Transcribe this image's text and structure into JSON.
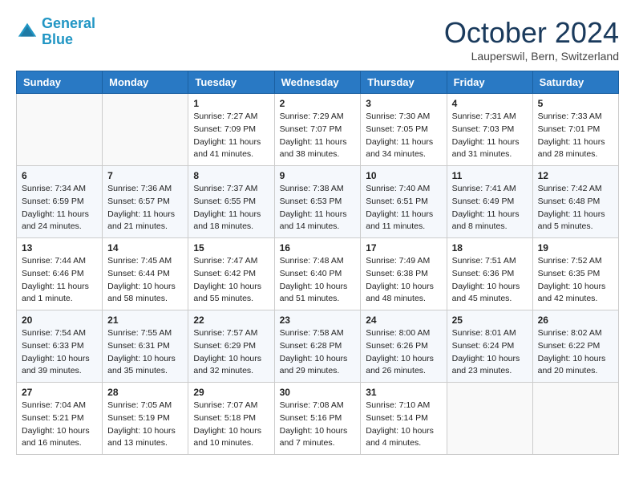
{
  "header": {
    "logo_general": "General",
    "logo_blue": "Blue",
    "title": "October 2024",
    "location": "Lauperswil, Bern, Switzerland"
  },
  "days_of_week": [
    "Sunday",
    "Monday",
    "Tuesday",
    "Wednesday",
    "Thursday",
    "Friday",
    "Saturday"
  ],
  "weeks": [
    [
      {
        "day": "",
        "sunrise": "",
        "sunset": "",
        "daylight": ""
      },
      {
        "day": "",
        "sunrise": "",
        "sunset": "",
        "daylight": ""
      },
      {
        "day": "1",
        "sunrise": "Sunrise: 7:27 AM",
        "sunset": "Sunset: 7:09 PM",
        "daylight": "Daylight: 11 hours and 41 minutes."
      },
      {
        "day": "2",
        "sunrise": "Sunrise: 7:29 AM",
        "sunset": "Sunset: 7:07 PM",
        "daylight": "Daylight: 11 hours and 38 minutes."
      },
      {
        "day": "3",
        "sunrise": "Sunrise: 7:30 AM",
        "sunset": "Sunset: 7:05 PM",
        "daylight": "Daylight: 11 hours and 34 minutes."
      },
      {
        "day": "4",
        "sunrise": "Sunrise: 7:31 AM",
        "sunset": "Sunset: 7:03 PM",
        "daylight": "Daylight: 11 hours and 31 minutes."
      },
      {
        "day": "5",
        "sunrise": "Sunrise: 7:33 AM",
        "sunset": "Sunset: 7:01 PM",
        "daylight": "Daylight: 11 hours and 28 minutes."
      }
    ],
    [
      {
        "day": "6",
        "sunrise": "Sunrise: 7:34 AM",
        "sunset": "Sunset: 6:59 PM",
        "daylight": "Daylight: 11 hours and 24 minutes."
      },
      {
        "day": "7",
        "sunrise": "Sunrise: 7:36 AM",
        "sunset": "Sunset: 6:57 PM",
        "daylight": "Daylight: 11 hours and 21 minutes."
      },
      {
        "day": "8",
        "sunrise": "Sunrise: 7:37 AM",
        "sunset": "Sunset: 6:55 PM",
        "daylight": "Daylight: 11 hours and 18 minutes."
      },
      {
        "day": "9",
        "sunrise": "Sunrise: 7:38 AM",
        "sunset": "Sunset: 6:53 PM",
        "daylight": "Daylight: 11 hours and 14 minutes."
      },
      {
        "day": "10",
        "sunrise": "Sunrise: 7:40 AM",
        "sunset": "Sunset: 6:51 PM",
        "daylight": "Daylight: 11 hours and 11 minutes."
      },
      {
        "day": "11",
        "sunrise": "Sunrise: 7:41 AM",
        "sunset": "Sunset: 6:49 PM",
        "daylight": "Daylight: 11 hours and 8 minutes."
      },
      {
        "day": "12",
        "sunrise": "Sunrise: 7:42 AM",
        "sunset": "Sunset: 6:48 PM",
        "daylight": "Daylight: 11 hours and 5 minutes."
      }
    ],
    [
      {
        "day": "13",
        "sunrise": "Sunrise: 7:44 AM",
        "sunset": "Sunset: 6:46 PM",
        "daylight": "Daylight: 11 hours and 1 minute."
      },
      {
        "day": "14",
        "sunrise": "Sunrise: 7:45 AM",
        "sunset": "Sunset: 6:44 PM",
        "daylight": "Daylight: 10 hours and 58 minutes."
      },
      {
        "day": "15",
        "sunrise": "Sunrise: 7:47 AM",
        "sunset": "Sunset: 6:42 PM",
        "daylight": "Daylight: 10 hours and 55 minutes."
      },
      {
        "day": "16",
        "sunrise": "Sunrise: 7:48 AM",
        "sunset": "Sunset: 6:40 PM",
        "daylight": "Daylight: 10 hours and 51 minutes."
      },
      {
        "day": "17",
        "sunrise": "Sunrise: 7:49 AM",
        "sunset": "Sunset: 6:38 PM",
        "daylight": "Daylight: 10 hours and 48 minutes."
      },
      {
        "day": "18",
        "sunrise": "Sunrise: 7:51 AM",
        "sunset": "Sunset: 6:36 PM",
        "daylight": "Daylight: 10 hours and 45 minutes."
      },
      {
        "day": "19",
        "sunrise": "Sunrise: 7:52 AM",
        "sunset": "Sunset: 6:35 PM",
        "daylight": "Daylight: 10 hours and 42 minutes."
      }
    ],
    [
      {
        "day": "20",
        "sunrise": "Sunrise: 7:54 AM",
        "sunset": "Sunset: 6:33 PM",
        "daylight": "Daylight: 10 hours and 39 minutes."
      },
      {
        "day": "21",
        "sunrise": "Sunrise: 7:55 AM",
        "sunset": "Sunset: 6:31 PM",
        "daylight": "Daylight: 10 hours and 35 minutes."
      },
      {
        "day": "22",
        "sunrise": "Sunrise: 7:57 AM",
        "sunset": "Sunset: 6:29 PM",
        "daylight": "Daylight: 10 hours and 32 minutes."
      },
      {
        "day": "23",
        "sunrise": "Sunrise: 7:58 AM",
        "sunset": "Sunset: 6:28 PM",
        "daylight": "Daylight: 10 hours and 29 minutes."
      },
      {
        "day": "24",
        "sunrise": "Sunrise: 8:00 AM",
        "sunset": "Sunset: 6:26 PM",
        "daylight": "Daylight: 10 hours and 26 minutes."
      },
      {
        "day": "25",
        "sunrise": "Sunrise: 8:01 AM",
        "sunset": "Sunset: 6:24 PM",
        "daylight": "Daylight: 10 hours and 23 minutes."
      },
      {
        "day": "26",
        "sunrise": "Sunrise: 8:02 AM",
        "sunset": "Sunset: 6:22 PM",
        "daylight": "Daylight: 10 hours and 20 minutes."
      }
    ],
    [
      {
        "day": "27",
        "sunrise": "Sunrise: 7:04 AM",
        "sunset": "Sunset: 5:21 PM",
        "daylight": "Daylight: 10 hours and 16 minutes."
      },
      {
        "day": "28",
        "sunrise": "Sunrise: 7:05 AM",
        "sunset": "Sunset: 5:19 PM",
        "daylight": "Daylight: 10 hours and 13 minutes."
      },
      {
        "day": "29",
        "sunrise": "Sunrise: 7:07 AM",
        "sunset": "Sunset: 5:18 PM",
        "daylight": "Daylight: 10 hours and 10 minutes."
      },
      {
        "day": "30",
        "sunrise": "Sunrise: 7:08 AM",
        "sunset": "Sunset: 5:16 PM",
        "daylight": "Daylight: 10 hours and 7 minutes."
      },
      {
        "day": "31",
        "sunrise": "Sunrise: 7:10 AM",
        "sunset": "Sunset: 5:14 PM",
        "daylight": "Daylight: 10 hours and 4 minutes."
      },
      {
        "day": "",
        "sunrise": "",
        "sunset": "",
        "daylight": ""
      },
      {
        "day": "",
        "sunrise": "",
        "sunset": "",
        "daylight": ""
      }
    ]
  ]
}
